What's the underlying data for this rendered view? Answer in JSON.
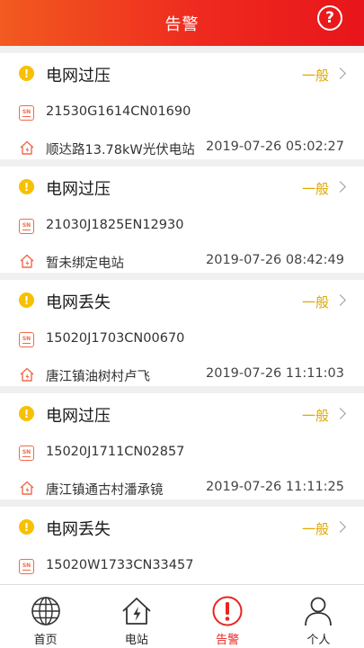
{
  "header": {
    "title": "告警",
    "help_symbol": "?"
  },
  "alarms": [
    {
      "title": "电网过压",
      "level": "一般",
      "sn": "21530G1614CN01690",
      "station": "顺达路13.78kW光伏电站",
      "time": "2019-07-26 05:02:27"
    },
    {
      "title": "电网过压",
      "level": "一般",
      "sn": "21030J1825EN12930",
      "station": "暂未绑定电站",
      "time": "2019-07-26 08:42:49"
    },
    {
      "title": "电网丢失",
      "level": "一般",
      "sn": "15020J1703CN00670",
      "station": "唐江镇油树村卢飞",
      "time": "2019-07-26 11:11:03"
    },
    {
      "title": "电网过压",
      "level": "一般",
      "sn": "15020J1711CN02857",
      "station": "唐江镇通古村潘承镜",
      "time": "2019-07-26 11:11:25"
    },
    {
      "title": "电网丢失",
      "level": "一般",
      "sn": "15020W1733CN33457",
      "station": "",
      "time": ""
    }
  ],
  "sn_badge": {
    "top": "SN",
    "icon": "sn-badge-icon"
  },
  "tabs": [
    {
      "label": "首页",
      "icon": "globe-icon"
    },
    {
      "label": "电站",
      "icon": "house-bolt-icon"
    },
    {
      "label": "告警",
      "icon": "alert-icon"
    },
    {
      "label": "个人",
      "icon": "person-icon"
    }
  ],
  "colors": {
    "accent": "#e8251f",
    "warning": "#f7c000",
    "level": "#e0a800"
  }
}
